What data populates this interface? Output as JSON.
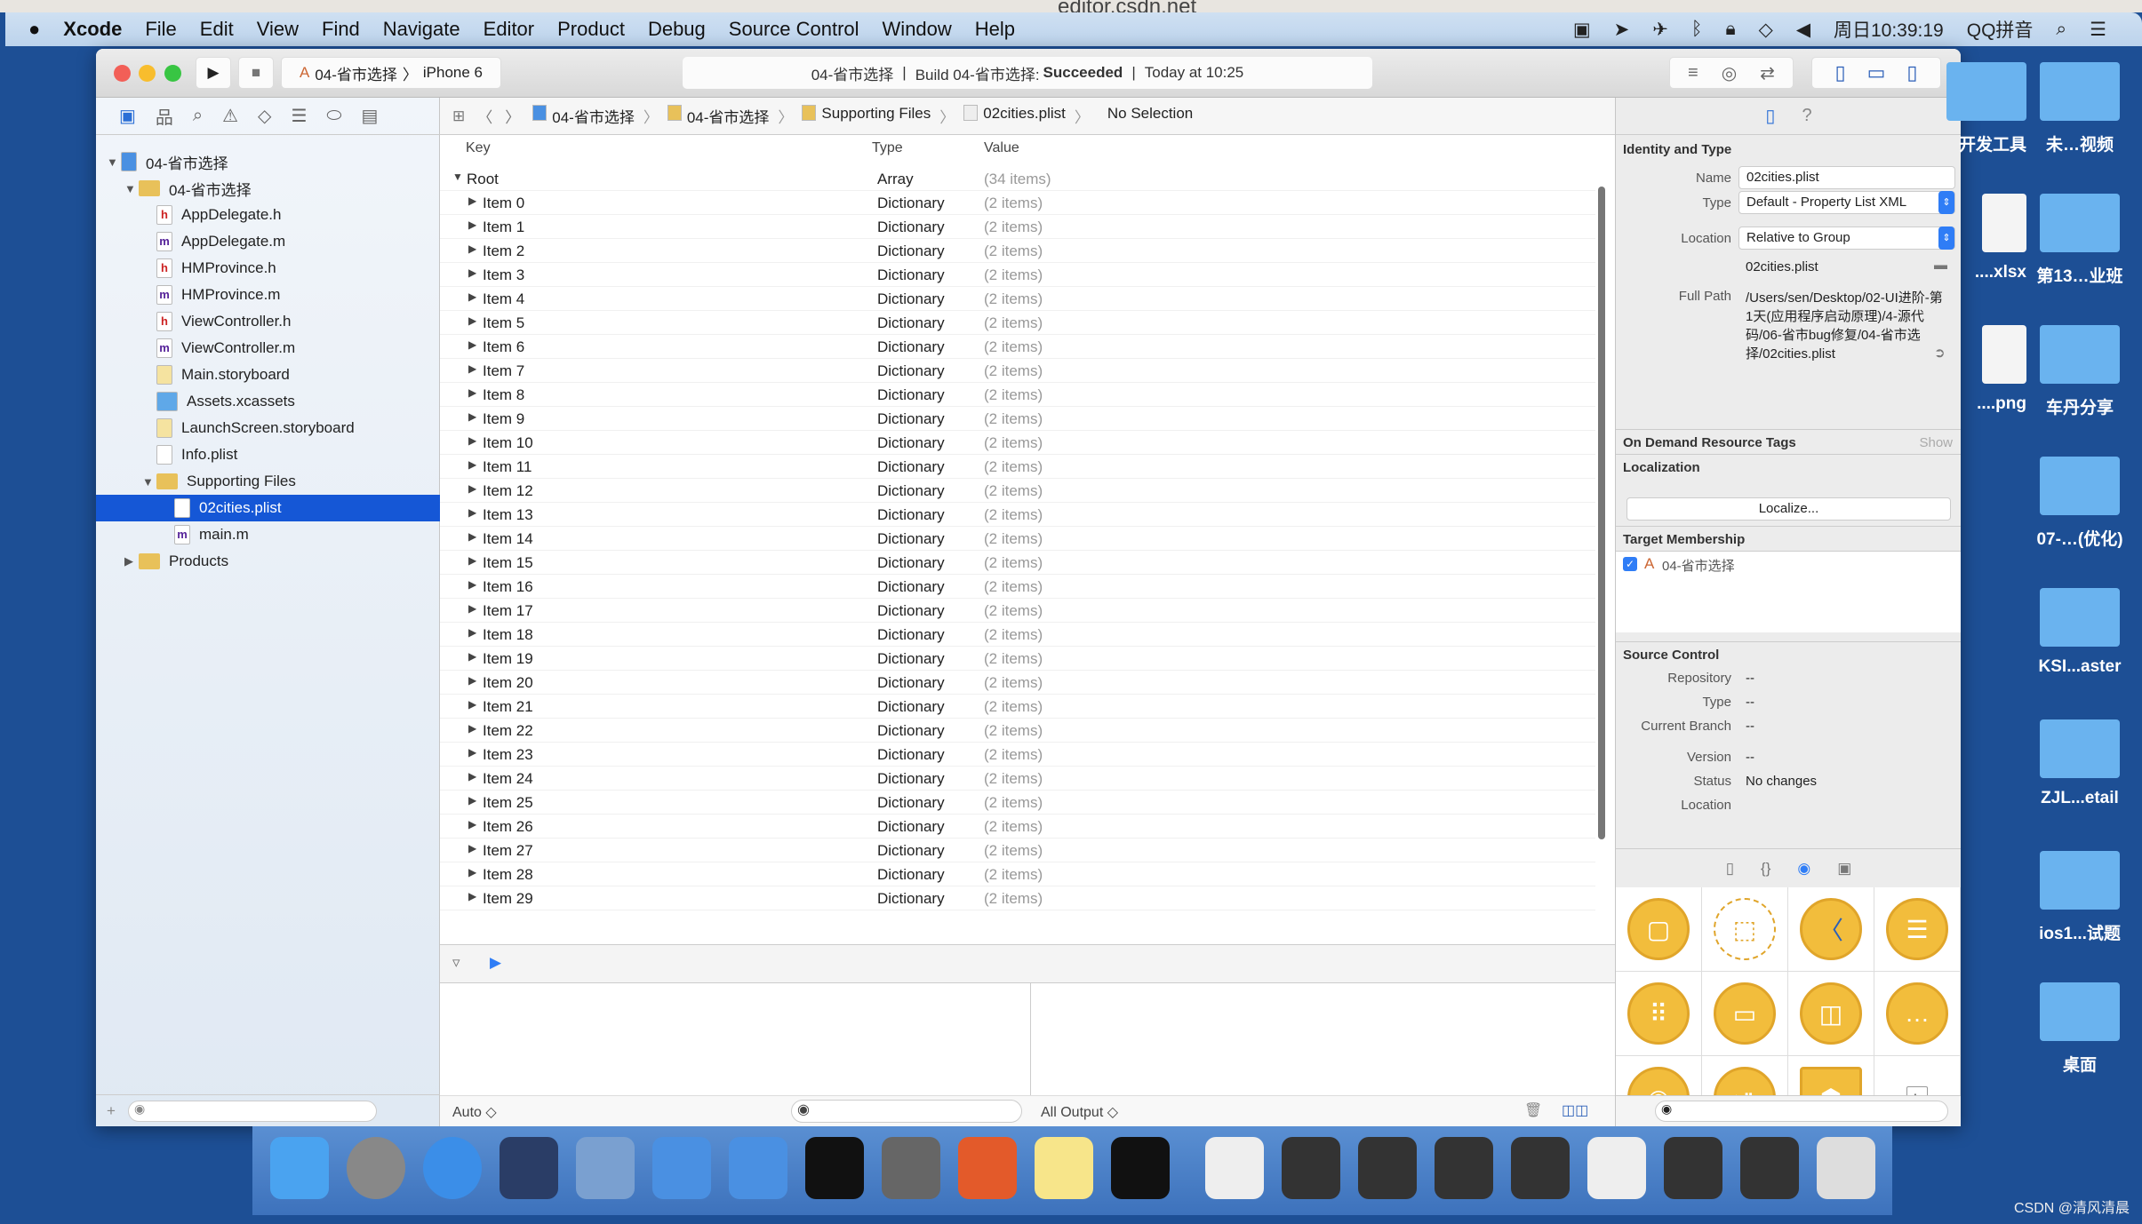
{
  "browser": {
    "url": "editor.csdn.net"
  },
  "menubar": {
    "app": "Xcode",
    "items": [
      "File",
      "Edit",
      "View",
      "Find",
      "Navigate",
      "Editor",
      "Product",
      "Debug",
      "Source Control",
      "Window",
      "Help"
    ],
    "clock": "周日10:39:19",
    "input_method": "QQ拼音"
  },
  "toolbar": {
    "scheme": "04-省市选择",
    "device": "iPhone 6",
    "activity_project": "04-省市选择",
    "activity_build": "Build 04-省市选择:",
    "activity_result": "Succeeded",
    "activity_time": "Today at 10:25"
  },
  "navigator": {
    "items": [
      {
        "label": "04-省市选择",
        "icon": "project-icon",
        "level": 0,
        "tri": "▼"
      },
      {
        "label": "04-省市选择",
        "icon": "folder-icon",
        "level": 1,
        "tri": "▼"
      },
      {
        "label": "AppDelegate.h",
        "icon": "h",
        "level": 2
      },
      {
        "label": "AppDelegate.m",
        "icon": "m",
        "level": 2
      },
      {
        "label": "HMProvince.h",
        "icon": "h",
        "level": 2
      },
      {
        "label": "HMProvince.m",
        "icon": "m",
        "level": 2
      },
      {
        "label": "ViewController.h",
        "icon": "h",
        "level": 2
      },
      {
        "label": "ViewController.m",
        "icon": "m",
        "level": 2
      },
      {
        "label": "Main.storyboard",
        "icon": "storyboard-icon",
        "level": 2
      },
      {
        "label": "Assets.xcassets",
        "icon": "assets-icon",
        "level": 2
      },
      {
        "label": "LaunchScreen.storyboard",
        "icon": "storyboard-icon",
        "level": 2
      },
      {
        "label": "Info.plist",
        "icon": "plist-icon",
        "level": 2
      },
      {
        "label": "Supporting Files",
        "icon": "folder-icon",
        "level": 2,
        "tri": "▼"
      },
      {
        "label": "02cities.plist",
        "icon": "plist-icon",
        "level": 3,
        "selected": true
      },
      {
        "label": "main.m",
        "icon": "m",
        "level": 3
      },
      {
        "label": "Products",
        "icon": "folder-icon",
        "level": 1,
        "tri": "▶"
      }
    ]
  },
  "jumpbar": [
    "04-省市选择",
    "04-省市选择",
    "Supporting Files",
    "02cities.plist",
    "No Selection"
  ],
  "plist": {
    "headers": {
      "key": "Key",
      "type": "Type",
      "value": "Value"
    },
    "root": {
      "key": "Root",
      "type": "Array",
      "value": "(34 items)"
    },
    "item_type": "Dictionary",
    "item_value": "(2 items)",
    "item_prefix": "Item",
    "visible_items": 30
  },
  "debug": {
    "auto": "Auto ◇",
    "output": "All Output ◇"
  },
  "inspector": {
    "identity_title": "Identity and Type",
    "name_label": "Name",
    "name_value": "02cities.plist",
    "type_label": "Type",
    "type_value": "Default - Property List XML",
    "location_label": "Location",
    "location_value": "Relative to Group",
    "location_file": "02cities.plist",
    "fullpath_label": "Full Path",
    "fullpath_value": "/Users/sen/Desktop/02-UI进阶-第1天(应用程序启动原理)/4-源代码/06-省市bug修复/04-省市选择/02cities.plist",
    "odr_title": "On Demand Resource Tags",
    "odr_show": "Show",
    "localization_title": "Localization",
    "localize_button": "Localize...",
    "target_title": "Target Membership",
    "target_name": "04-省市选择",
    "target_checked": true,
    "sc_title": "Source Control",
    "repository_label": "Repository",
    "repository_value": "--",
    "sctype_label": "Type",
    "sctype_value": "--",
    "branch_label": "Current Branch",
    "branch_value": "--",
    "version_label": "Version",
    "version_value": "--",
    "status_label": "Status",
    "status_value": "No changes",
    "sclocation_label": "Location"
  },
  "desktop": {
    "left_column": [
      "开发工具",
      "....xlsx",
      "....png"
    ],
    "right_column": [
      "未…视频",
      "第13…业班",
      "车丹分享",
      "07-…(优化)",
      "KSI...aster",
      "ZJL...etail",
      "ios1...试题",
      "桌面"
    ]
  },
  "watermark": "CSDN @清风清晨",
  "colors": {
    "selection": "#1557d6",
    "accent": "#2f7df6",
    "library_icon": "#f2bd3c",
    "desktop": "#1d4f95"
  }
}
